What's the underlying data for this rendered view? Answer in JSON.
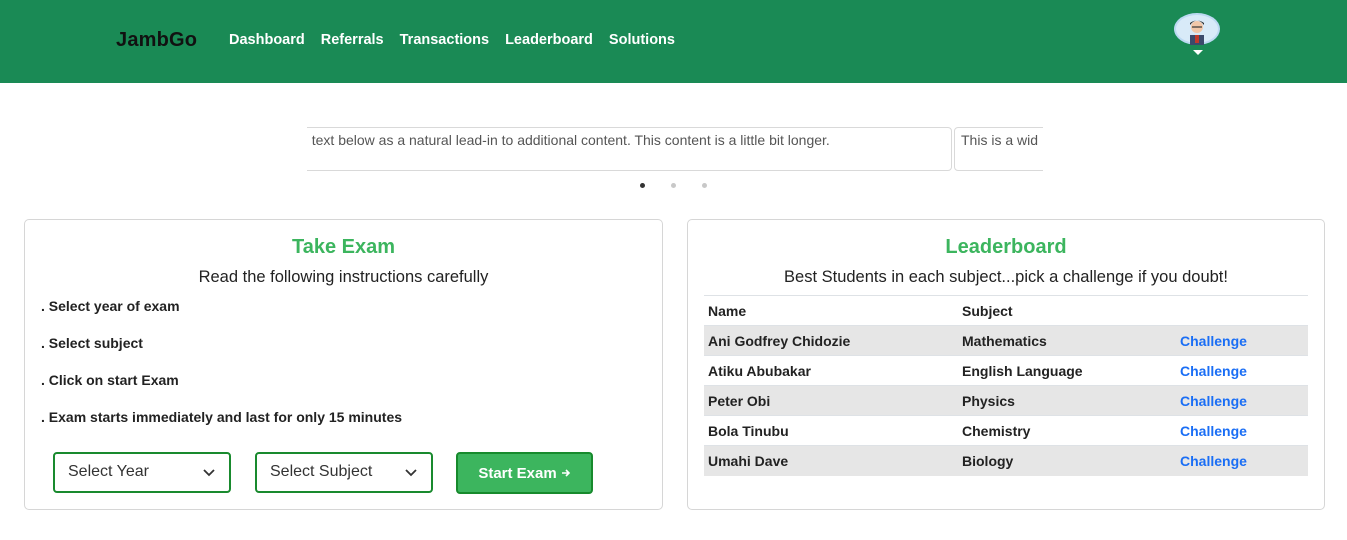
{
  "nav": {
    "brand": "JambGo",
    "links": [
      "Dashboard",
      "Referrals",
      "Transactions",
      "Leaderboard",
      "Solutions"
    ]
  },
  "carousel": {
    "slide_text": "This is a wider card with supporting text below as a natural lead-in to additional content. This content is a little bit longer.",
    "next_slide_text": "This is a wid"
  },
  "exam": {
    "title": "Take Exam",
    "subtitle": "Read the following instructions carefully",
    "instructions": [
      ". Select year of exam",
      ". Select subject",
      ". Click on start Exam",
      ". Exam starts immediately and last for only 15 minutes"
    ],
    "year_select": "Select Year",
    "subject_select": "Select Subject",
    "start_label": "Start Exam"
  },
  "leaderboard": {
    "title": "Leaderboard",
    "subtitle": "Best Students in each subject...pick a challenge if you doubt!",
    "headers": [
      "Name",
      "Subject"
    ],
    "challenge_label": "Challenge",
    "rows": [
      {
        "name": "Ani Godfrey Chidozie",
        "subject": "Mathematics"
      },
      {
        "name": "Atiku Abubakar",
        "subject": "English Language"
      },
      {
        "name": "Peter Obi",
        "subject": "Physics"
      },
      {
        "name": "Bola Tinubu",
        "subject": "Chemistry"
      },
      {
        "name": "Umahi Dave",
        "subject": "Biology"
      }
    ]
  },
  "colors": {
    "navbar": "#1a8a55",
    "accent_green": "#3cb55e",
    "border_green": "#198a2e",
    "link_blue": "#1a6ef5"
  }
}
